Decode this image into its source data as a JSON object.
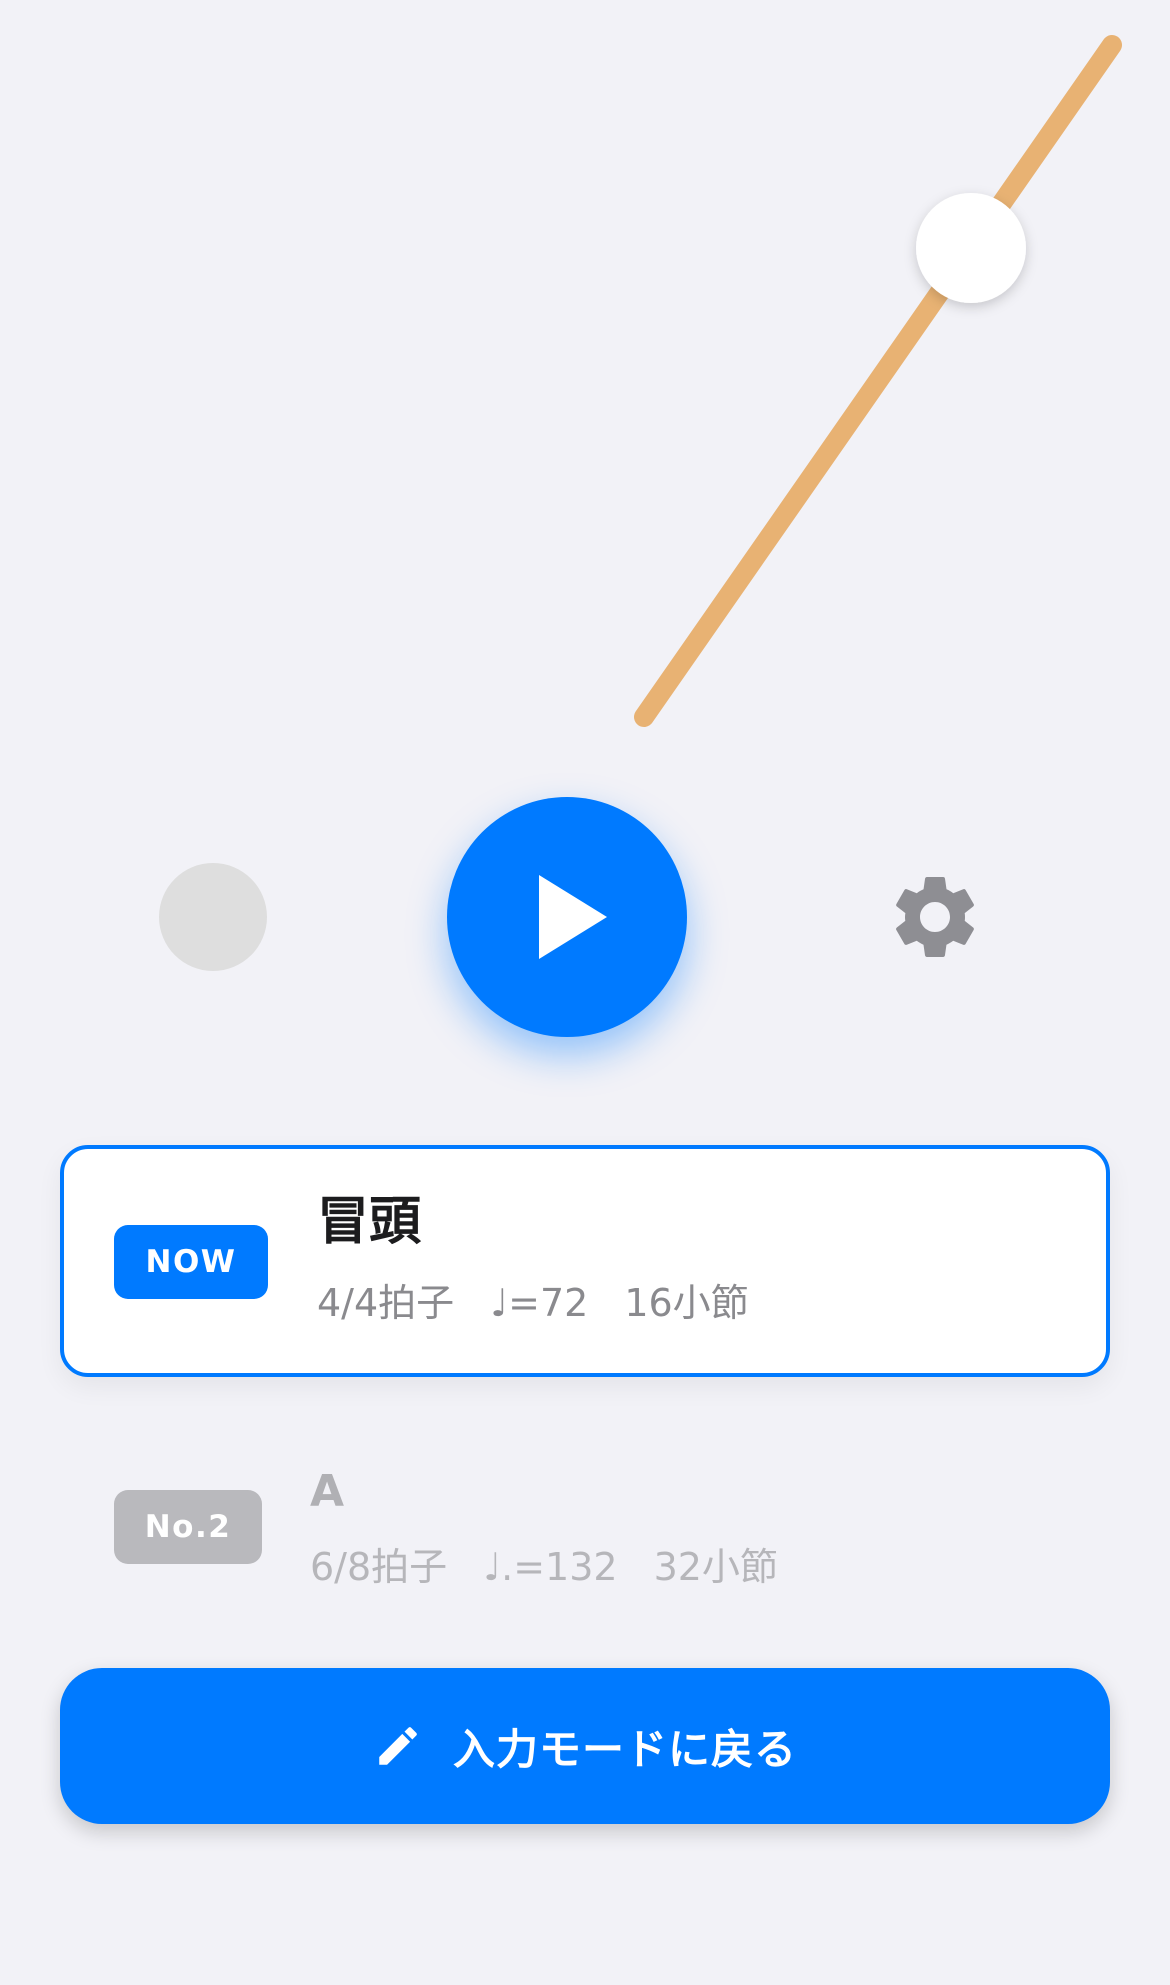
{
  "metronome": {
    "pendulum_color": "#e8b273",
    "weight_color": "#ffffff"
  },
  "controls": {
    "beat_indicator_color": "#dedede",
    "play_icon": "play-icon",
    "settings_icon": "gear-icon"
  },
  "current_section": {
    "badge": "NOW",
    "title": "冒頭",
    "time_signature": "4/4拍子",
    "tempo_note": "♩",
    "tempo_value": "=72",
    "measures": "16小節"
  },
  "next_section": {
    "badge": "No.2",
    "title": "A",
    "time_signature": "6/8拍子",
    "tempo_note": "♩.",
    "tempo_value": "=132",
    "measures": "32小節"
  },
  "footer": {
    "back_label": "入力モードに戻る",
    "icon": "pencil-icon"
  },
  "colors": {
    "accent": "#007aff",
    "background": "#f2f2f7",
    "inactive_badge": "#b9b9bd"
  }
}
